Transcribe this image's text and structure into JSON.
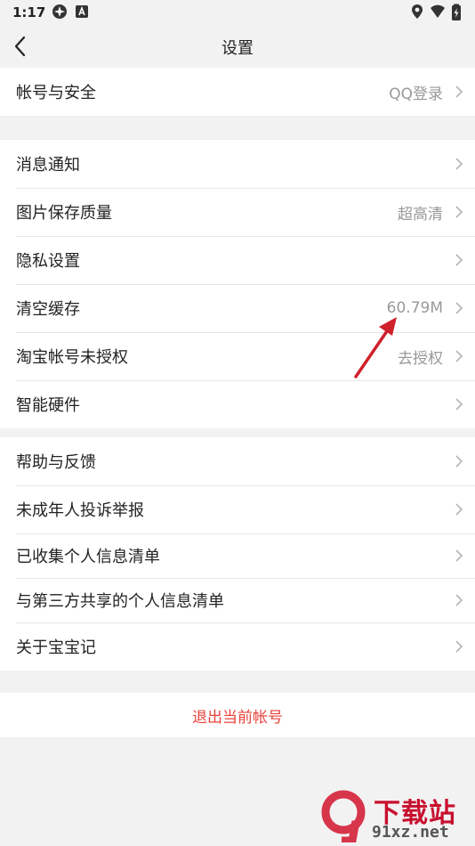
{
  "status_bar": {
    "time": "1:17"
  },
  "header": {
    "title": "设置"
  },
  "groups": [
    {
      "items": [
        {
          "label": "帐号与安全",
          "value": "QQ登录"
        }
      ]
    },
    {
      "items": [
        {
          "label": "消息通知",
          "value": ""
        },
        {
          "label": "图片保存质量",
          "value": "超高清"
        },
        {
          "label": "隐私设置",
          "value": ""
        },
        {
          "label": "清空缓存",
          "value": "60.79M"
        },
        {
          "label": "淘宝帐号未授权",
          "value": "去授权"
        },
        {
          "label": "智能硬件",
          "value": ""
        }
      ]
    },
    {
      "items": [
        {
          "label": "帮助与反馈",
          "value": ""
        },
        {
          "label": "未成年人投诉举报",
          "value": ""
        },
        {
          "label": "已收集个人信息清单",
          "value": ""
        },
        {
          "label": "与第三方共享的个人信息清单",
          "value": ""
        },
        {
          "label": "关于宝宝记",
          "value": ""
        }
      ]
    }
  ],
  "logout": {
    "label": "退出当前帐号"
  },
  "watermark": {
    "main": "下载站",
    "sub": "91xz.net"
  },
  "colors": {
    "accent": "#e8423b",
    "arrow": "#d0202a",
    "value_text": "#999999"
  }
}
